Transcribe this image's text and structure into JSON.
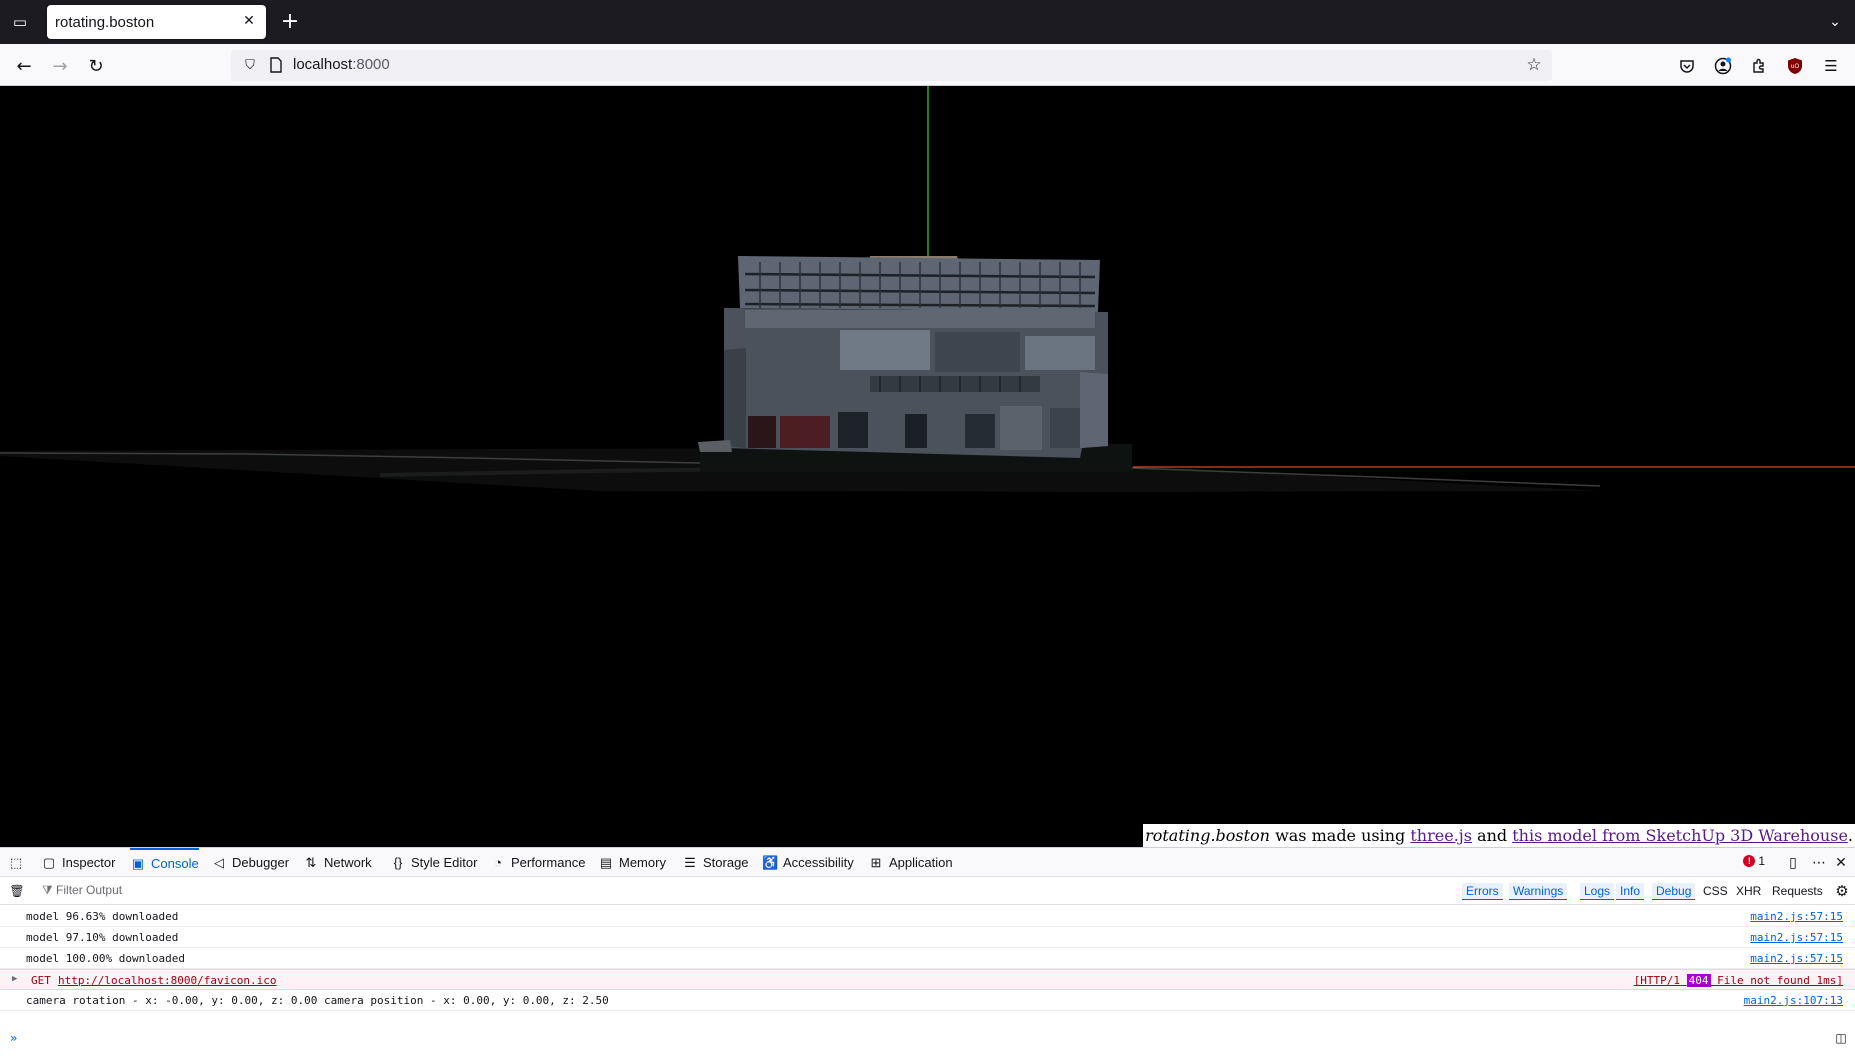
{
  "browser": {
    "tab_title": "rotating.boston",
    "url_host": "localhost",
    "url_port": ":8000"
  },
  "page": {
    "credit_site": "rotating.boston",
    "credit_text1": " was made using ",
    "credit_link1": "three.js",
    "credit_text2": " and ",
    "credit_link2": "this model from SketchUp 3D Warehouse",
    "credit_end": "."
  },
  "devtools": {
    "tabs": [
      {
        "label": "Inspector",
        "icon": "inspector-icon"
      },
      {
        "label": "Console",
        "icon": "console-icon"
      },
      {
        "label": "Debugger",
        "icon": "debugger-icon"
      },
      {
        "label": "Network",
        "icon": "network-icon"
      },
      {
        "label": "Style Editor",
        "icon": "style-editor-icon"
      },
      {
        "label": "Performance",
        "icon": "performance-icon"
      },
      {
        "label": "Memory",
        "icon": "memory-icon"
      },
      {
        "label": "Storage",
        "icon": "storage-icon"
      },
      {
        "label": "Accessibility",
        "icon": "accessibility-icon"
      },
      {
        "label": "Application",
        "icon": "application-icon"
      }
    ],
    "selected_tab": "Console",
    "error_count": "1",
    "filter_placeholder": "Filter Output",
    "filters": {
      "errors": "Errors",
      "warnings": "Warnings",
      "logs": "Logs",
      "info": "Info",
      "debug": "Debug",
      "css": "CSS",
      "xhr": "XHR",
      "requests": "Requests"
    },
    "logs": [
      {
        "msg": "model 96.63% downloaded",
        "src": "main2.js:57:15"
      },
      {
        "msg": "model 97.10% downloaded",
        "src": "main2.js:57:15"
      },
      {
        "msg": "model 100.00% downloaded",
        "src": "main2.js:57:15"
      }
    ],
    "error_log": {
      "method": "GET",
      "url": "http://localhost:8000/favicon.ico",
      "status_prefix": "[HTTP/1",
      "status_code": "404",
      "status_suffix": " File not found 1ms]"
    },
    "last_log": {
      "msg": "camera rotation - x: -0.00, y: 0.00, z: 0.00 camera position - x: 0.00, y: 0.00, z: 2.50",
      "src": "main2.js:107:13"
    },
    "prompt": "»"
  }
}
